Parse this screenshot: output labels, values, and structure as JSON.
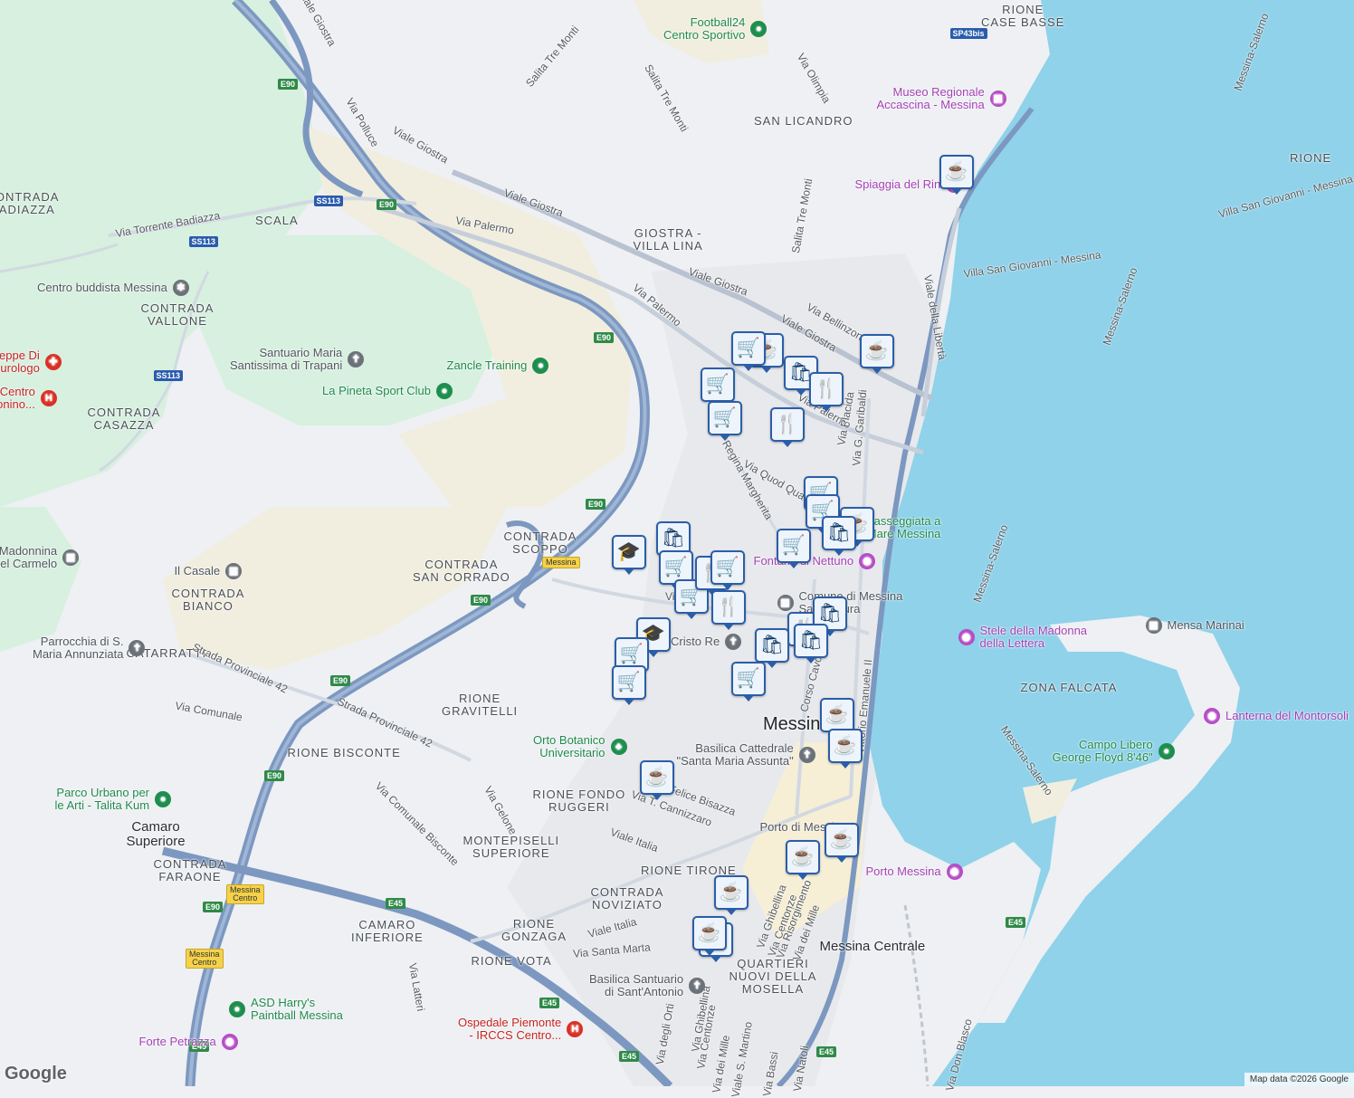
{
  "map": {
    "attribution": "Map data ©2026 Google",
    "logo": "Google",
    "colors": {
      "sea": "#8fd2ea",
      "land": "#eef0f3",
      "park": "#d7f0df",
      "hills": "#f1eedf",
      "motorway": "#7c98c0",
      "marker_border": "#2b5ea8",
      "marker_icon": "#0f3a68"
    }
  },
  "areas": [
    {
      "id": "rione-case-basse",
      "lines": [
        "RIONE",
        "CASE BASSE"
      ]
    },
    {
      "id": "rione-right",
      "lines": [
        "RIONE"
      ]
    },
    {
      "id": "contrada-badiazza",
      "lines": [
        "CONTRADA",
        "BADIAZZA"
      ]
    },
    {
      "id": "scala",
      "lines": [
        "SCALA"
      ]
    },
    {
      "id": "contrada-vallone",
      "lines": [
        "CONTRADA",
        "VALLONE"
      ]
    },
    {
      "id": "contrada-casazza",
      "lines": [
        "CONTRADA",
        "CASAZZA"
      ]
    },
    {
      "id": "san-licandro",
      "lines": [
        "SAN LICANDRO"
      ]
    },
    {
      "id": "giostra-villa-lina",
      "lines": [
        "GIOSTRA -",
        "VILLA LINA"
      ]
    },
    {
      "id": "contrada-scoppo",
      "lines": [
        "CONTRADA",
        "SCOPPO"
      ]
    },
    {
      "id": "contrada-san-corrado",
      "lines": [
        "CONTRADA",
        "SAN CORRADO"
      ]
    },
    {
      "id": "contrada-bianco",
      "lines": [
        "CONTRADA",
        "BIANCO"
      ]
    },
    {
      "id": "catarratti",
      "lines": [
        "CATARRATTI"
      ]
    },
    {
      "id": "rione-gravitelli",
      "lines": [
        "RIONE",
        "GRAVITELLI"
      ]
    },
    {
      "id": "rione-bisconte",
      "lines": [
        "RIONE BISCONTE"
      ]
    },
    {
      "id": "rione-fondo-ruggeri",
      "lines": [
        "RIONE FONDO",
        "RUGGERI"
      ]
    },
    {
      "id": "zona-falcata",
      "lines": [
        "ZONA FALCATA"
      ]
    },
    {
      "id": "montepiselli-superiore",
      "lines": [
        "MONTEPISELLI",
        "SUPERIORE"
      ]
    },
    {
      "id": "rione-tirone",
      "lines": [
        "RIONE TIRONE"
      ]
    },
    {
      "id": "contrada-faraone",
      "lines": [
        "CONTRADA",
        "FARAONE"
      ]
    },
    {
      "id": "contrada-noviziato",
      "lines": [
        "CONTRADA",
        "NOVIZIATO"
      ]
    },
    {
      "id": "camaro-inferiore",
      "lines": [
        "CAMARO",
        "INFERIORE"
      ]
    },
    {
      "id": "rione-gonzaga",
      "lines": [
        "RIONE",
        "GONZAGA"
      ]
    },
    {
      "id": "rione-vota",
      "lines": [
        "RIONE VOTA"
      ]
    },
    {
      "id": "quartieri-nuovi",
      "lines": [
        "QUARTIERI",
        "NUOVI DELLA",
        "MOSELLA"
      ]
    }
  ],
  "cities": [
    {
      "id": "messina",
      "label": "Messina"
    },
    {
      "id": "camaro-superiore",
      "lines": [
        "Camaro",
        "Superiore"
      ]
    },
    {
      "id": "messina-centrale",
      "label": "Messina Centrale"
    }
  ],
  "streets": [
    {
      "id": "viale-giostra-top",
      "label": "Viale Giostra"
    },
    {
      "id": "salita-tre-monti-1",
      "label": "Salita Tre Monti"
    },
    {
      "id": "salita-tre-monti-2",
      "label": "Salita Tre Monti"
    },
    {
      "id": "via-olimpia",
      "label": "Via Olimpia"
    },
    {
      "id": "via-polluce",
      "label": "Via Polluce"
    },
    {
      "id": "viale-giostra-2",
      "label": "Viale Giostra"
    },
    {
      "id": "viale-giostra-3",
      "label": "Viale Giostra"
    },
    {
      "id": "viale-giostra-4",
      "label": "Viale Giostra"
    },
    {
      "id": "viale-giostra-5",
      "label": "Viale Giostra"
    },
    {
      "id": "salita-tre-monti-3",
      "label": "Salita Tre Monti"
    },
    {
      "id": "via-torrente-badiazza",
      "label": "Via Torrente Badiazza"
    },
    {
      "id": "via-palermo-1",
      "label": "Via Palermo"
    },
    {
      "id": "via-palermo-2",
      "label": "Via Palermo"
    },
    {
      "id": "via-palermo-3",
      "label": "Via Palermo"
    },
    {
      "id": "via-bellinzona",
      "label": "Via Bellinzona"
    },
    {
      "id": "viale-della-liberta",
      "label": "Viale della Libertà"
    },
    {
      "id": "via-placida",
      "label": "Via Placida"
    },
    {
      "id": "via-g-garibaldi",
      "label": "Via G. Garibaldi"
    },
    {
      "id": "regina-margherita",
      "label": "Regina Margherita"
    },
    {
      "id": "via-quod-quaeris",
      "label": "Via Quod Quaeris"
    },
    {
      "id": "villa-san-giovanni-1",
      "label": "Villa San Giovanni - Messina"
    },
    {
      "id": "villa-san-giovanni-2",
      "label": "Villa San Giovanni - Messina"
    },
    {
      "id": "messina-salerno-1",
      "label": "Messina-Salerno"
    },
    {
      "id": "messina-salerno-2",
      "label": "Messina-Salerno"
    },
    {
      "id": "messina-salerno-3",
      "label": "Messina-Salerno"
    },
    {
      "id": "messina-salerno-4",
      "label": "Messina-Salerno"
    },
    {
      "id": "strada-provinciale-42-1",
      "label": "Strada Provinciale 42"
    },
    {
      "id": "strada-provinciale-42-2",
      "label": "Strada Provinciale 42"
    },
    {
      "id": "via-comunale",
      "label": "Via Comunale"
    },
    {
      "id": "via-comunale-bisconte",
      "label": "Via Comunale Bisconte"
    },
    {
      "id": "via-gelone",
      "label": "Via Gelone"
    },
    {
      "id": "corso-cavour",
      "label": "Corso Cavour"
    },
    {
      "id": "viale-emanuele",
      "label": "Vittorio Emanuele II"
    },
    {
      "id": "via-t-cannizzaro",
      "label": "Via T. Cannizzaro"
    },
    {
      "id": "felice-bisazza",
      "label": "Felice Bisazza"
    },
    {
      "id": "viale-italia-1",
      "label": "Viale Italia"
    },
    {
      "id": "viale-italia-2",
      "label": "Viale Italia"
    },
    {
      "id": "via-santa-marta",
      "label": "Via Santa Marta"
    },
    {
      "id": "via-ghibellina-1",
      "label": "Via Ghibellina"
    },
    {
      "id": "via-centonze-1",
      "label": "Via Centonze"
    },
    {
      "id": "via-risorgimento",
      "label": "Via Risorgimento"
    },
    {
      "id": "via-dei-mille-1",
      "label": "Via dei Mille"
    },
    {
      "id": "via-latteri",
      "label": "Via Latteri"
    },
    {
      "id": "via-degli-orti",
      "label": "Via degli Orti"
    },
    {
      "id": "via-ghibellina-2",
      "label": "Via Ghibellina"
    },
    {
      "id": "via-centonze-2",
      "label": "Via Centonze"
    },
    {
      "id": "via-dei-mille-2",
      "label": "Via dei Mille"
    },
    {
      "id": "viale-s-martino",
      "label": "Viale S. Martino"
    },
    {
      "id": "via-natoli",
      "label": "Via Natoli"
    },
    {
      "id": "via-bassi",
      "label": "Via Bassi"
    },
    {
      "id": "via-don-blasco",
      "label": "Via Don Blasco"
    },
    {
      "id": "via-partial",
      "label": "Vi"
    }
  ],
  "shields": [
    {
      "id": "sp43bis",
      "label": "SP43bis",
      "kind": "blue"
    },
    {
      "id": "e90-a",
      "label": "E90",
      "kind": "green"
    },
    {
      "id": "ss113-a",
      "label": "SS113",
      "kind": "blue"
    },
    {
      "id": "e90-b",
      "label": "E90",
      "kind": "green"
    },
    {
      "id": "ss113-b",
      "label": "SS113",
      "kind": "blue"
    },
    {
      "id": "ss113-c",
      "label": "SS113",
      "kind": "blue"
    },
    {
      "id": "e90-c",
      "label": "E90",
      "kind": "green"
    },
    {
      "id": "e90-d",
      "label": "E90",
      "kind": "green"
    },
    {
      "id": "e90-e",
      "label": "E90",
      "kind": "green"
    },
    {
      "id": "e90-f",
      "label": "E90",
      "kind": "green"
    },
    {
      "id": "e90-g",
      "label": "E90",
      "kind": "green"
    },
    {
      "id": "e90-h",
      "label": "E90",
      "kind": "green"
    },
    {
      "id": "e45-a",
      "label": "E45",
      "kind": "green"
    },
    {
      "id": "e45-b",
      "label": "E45",
      "kind": "green"
    },
    {
      "id": "e45-c",
      "label": "E45",
      "kind": "green"
    },
    {
      "id": "e45-d",
      "label": "E45",
      "kind": "green"
    },
    {
      "id": "e45-e",
      "label": "E45",
      "kind": "green"
    },
    {
      "id": "e45-f",
      "label": "E45",
      "kind": "green"
    },
    {
      "id": "exit-messina",
      "label": "Messina",
      "kind": "yellow"
    },
    {
      "id": "exit-messina-centro-1",
      "label": "Messina Centro",
      "kind": "yellow"
    },
    {
      "id": "exit-messina-centro-2",
      "label": "Messina Centro",
      "kind": "yellow"
    }
  ],
  "pois": [
    {
      "id": "football24",
      "lines": [
        "Football24",
        "Centro Sportivo"
      ],
      "kind": "green",
      "glyph": "●"
    },
    {
      "id": "museo-accascina",
      "lines": [
        "Museo Regionale",
        "Accascina - Messina"
      ],
      "kind": "purple",
      "glyph": "▥"
    },
    {
      "id": "spiaggia-rin",
      "lines": [
        "Spiaggia del Rin"
      ],
      "kind": "purple",
      "glyph": "◉"
    },
    {
      "id": "centro-buddista",
      "lines": [
        "Centro buddista Messina"
      ],
      "kind": "gray",
      "glyph": "✻"
    },
    {
      "id": "santuario-trapani",
      "lines": [
        "Santuario Maria",
        "Santissima di Trapani"
      ],
      "kind": "gray",
      "glyph": "✝"
    },
    {
      "id": "zancle-training",
      "lines": [
        "Zancle Training"
      ],
      "kind": "green",
      "glyph": "●"
    },
    {
      "id": "la-pineta",
      "lines": [
        "La Pineta Sport Club"
      ],
      "kind": "green",
      "glyph": "●"
    },
    {
      "id": "giuseppe-neurologo",
      "lines": [
        "seppe Di",
        "eurologo"
      ],
      "kind": "red",
      "glyph": "✚"
    },
    {
      "id": "centro-bonino",
      "lines": [
        "S Centro",
        "Bonino..."
      ],
      "kind": "red",
      "glyph": "H"
    },
    {
      "id": "madonnina-carmelo",
      "lines": [
        "Madonnina",
        "del Carmelo"
      ],
      "kind": "gray",
      "glyph": "▥"
    },
    {
      "id": "il-casale",
      "lines": [
        "Il Casale"
      ],
      "kind": "gray",
      "glyph": "▥"
    },
    {
      "id": "fontana-nettuno",
      "lines": [
        "Fontana di Nettuno"
      ],
      "kind": "purple",
      "glyph": "◉"
    },
    {
      "id": "passeggiata",
      "lines": [
        "Passeggiata a",
        "Mare Messina"
      ],
      "kind": "green",
      "glyph": ""
    },
    {
      "id": "comune-messina",
      "lines": [
        "Comune di Messina",
        "SalaCultura"
      ],
      "kind": "gray",
      "glyph": "▥"
    },
    {
      "id": "cristo-re",
      "lines": [
        "Cristo Re"
      ],
      "kind": "gray",
      "glyph": "✝"
    },
    {
      "id": "stele-madonna",
      "lines": [
        "Stele della Madonna",
        "della Lettera"
      ],
      "kind": "purple",
      "glyph": "◉"
    },
    {
      "id": "mensa-marinai",
      "lines": [
        "Mensa Marinai"
      ],
      "kind": "gray",
      "glyph": "▥"
    },
    {
      "id": "parrocchia-annunziata",
      "lines": [
        "Parrocchia di S.",
        "Maria Annunziata"
      ],
      "kind": "gray",
      "glyph": "✝"
    },
    {
      "id": "lanterna-montorsoli",
      "lines": [
        "Lanterna del Montorsoli"
      ],
      "kind": "purple",
      "glyph": "◉"
    },
    {
      "id": "orto-botanico",
      "lines": [
        "Orto Botanico",
        "Universitario"
      ],
      "kind": "green",
      "glyph": "♣"
    },
    {
      "id": "basilica-cattedrale",
      "lines": [
        "Basilica Cattedrale",
        "\"Santa Maria Assunta\""
      ],
      "kind": "gray",
      "glyph": "✝"
    },
    {
      "id": "campo-libero",
      "lines": [
        "Campo Libero",
        "George Floyd 8'46\""
      ],
      "kind": "green",
      "glyph": "●"
    },
    {
      "id": "parco-urbano",
      "lines": [
        "Parco Urbano per",
        "le Arti - Talita Kum"
      ],
      "kind": "green",
      "glyph": "●"
    },
    {
      "id": "porto-di-messina",
      "lines": [
        "Porto di Messina"
      ],
      "kind": "gray",
      "glyph": ""
    },
    {
      "id": "porto-messina",
      "lines": [
        "Porto Messina"
      ],
      "kind": "purple",
      "glyph": "◉"
    },
    {
      "id": "basilica-antonio",
      "lines": [
        "Basilica Santuario",
        "di Sant'Antonio"
      ],
      "kind": "gray",
      "glyph": "✝"
    },
    {
      "id": "asd-harrys",
      "lines": [
        "ASD Harry's",
        "Paintball Messina"
      ],
      "kind": "green",
      "glyph": "●"
    },
    {
      "id": "ospedale-piemonte",
      "lines": [
        "Ospedale Piemonte",
        "- IRCCS Centro..."
      ],
      "kind": "red",
      "glyph": "H"
    },
    {
      "id": "forte-petrazza",
      "lines": [
        "Forte Petrazza"
      ],
      "kind": "purple",
      "glyph": "◉"
    }
  ],
  "markers": [
    {
      "id": "m-cafe-riviera",
      "type": "cafe",
      "icon": "☕"
    },
    {
      "id": "m-cafe-giostra",
      "type": "cafe",
      "icon": "☕"
    },
    {
      "id": "m-cafe-1",
      "type": "cafe",
      "icon": "☕"
    },
    {
      "id": "m-cart-1",
      "type": "shopping-cart",
      "icon": "🛒"
    },
    {
      "id": "m-bag-1",
      "type": "shopping-bag",
      "icon": "🛍"
    },
    {
      "id": "m-food-1",
      "type": "restaurant",
      "icon": "🍴"
    },
    {
      "id": "m-cart-2",
      "type": "shopping-cart",
      "icon": "🛒"
    },
    {
      "id": "m-cart-3",
      "type": "shopping-cart",
      "icon": "🛒"
    },
    {
      "id": "m-food-2",
      "type": "restaurant",
      "icon": "🍴"
    },
    {
      "id": "m-cart-4",
      "type": "shopping-cart",
      "icon": "🛒"
    },
    {
      "id": "m-cart-5",
      "type": "shopping-cart",
      "icon": "🛒"
    },
    {
      "id": "m-cafe-2",
      "type": "cafe",
      "icon": "☕"
    },
    {
      "id": "m-bag-2",
      "type": "shopping-bag",
      "icon": "🛍"
    },
    {
      "id": "m-cart-6",
      "type": "shopping-cart",
      "icon": "🛒"
    },
    {
      "id": "m-school-1",
      "type": "school",
      "icon": "🎓"
    },
    {
      "id": "m-bag-3",
      "type": "shopping-bag",
      "icon": "🛍"
    },
    {
      "id": "m-cart-7",
      "type": "shopping-cart",
      "icon": "🛒"
    },
    {
      "id": "m-cart-8",
      "type": "shopping-cart",
      "icon": "🛒"
    },
    {
      "id": "m-food-3",
      "type": "restaurant",
      "icon": "🍴"
    },
    {
      "id": "m-cart-9",
      "type": "shopping-cart",
      "icon": "🛒"
    },
    {
      "id": "m-food-4",
      "type": "restaurant",
      "icon": "🍴"
    },
    {
      "id": "m-food-5",
      "type": "restaurant",
      "icon": "🍴"
    },
    {
      "id": "m-bag-4",
      "type": "shopping-bag",
      "icon": "🛍"
    },
    {
      "id": "m-bag-5",
      "type": "shopping-bag",
      "icon": "🛍"
    },
    {
      "id": "m-bag-6",
      "type": "shopping-bag",
      "icon": "🛍"
    },
    {
      "id": "m-school-2",
      "type": "school",
      "icon": "🎓"
    },
    {
      "id": "m-cart-10",
      "type": "shopping-cart",
      "icon": "🛒"
    },
    {
      "id": "m-cart-11",
      "type": "shopping-cart",
      "icon": "🛒"
    },
    {
      "id": "m-cart-12",
      "type": "shopping-cart",
      "icon": "🛒"
    },
    {
      "id": "m-cafe-3",
      "type": "cafe",
      "icon": "☕"
    },
    {
      "id": "m-cafe-4",
      "type": "cafe",
      "icon": "☕"
    },
    {
      "id": "m-cafe-5",
      "type": "cafe",
      "icon": "☕"
    },
    {
      "id": "m-cafe-6",
      "type": "cafe",
      "icon": "☕"
    },
    {
      "id": "m-cafe-7",
      "type": "cafe",
      "icon": "☕"
    },
    {
      "id": "m-cafe-8",
      "type": "cafe",
      "icon": "☕"
    },
    {
      "id": "m-cafe-9",
      "type": "cafe",
      "icon": "☕"
    },
    {
      "id": "m-cafe-10",
      "type": "cafe",
      "icon": "☕"
    }
  ]
}
